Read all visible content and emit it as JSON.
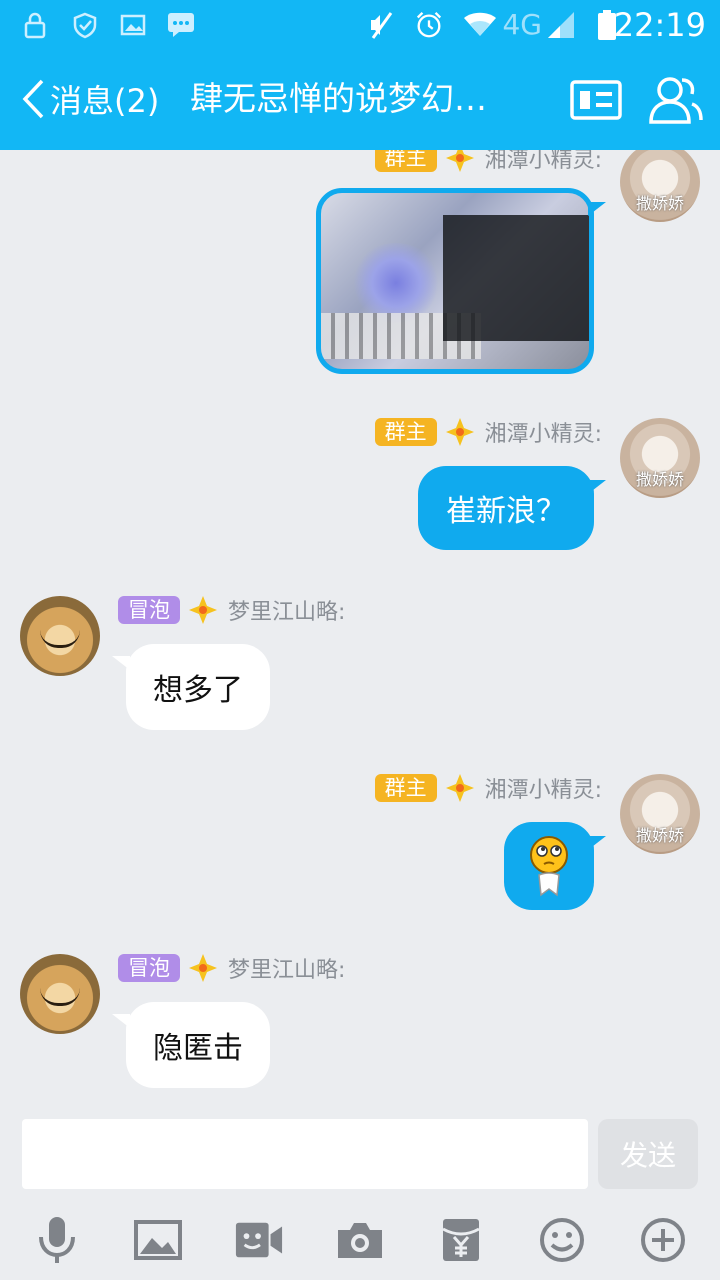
{
  "status_bar": {
    "network": "4G",
    "time": "22:19",
    "icons": [
      "lock-icon",
      "shield-icon",
      "image-icon",
      "message-icon",
      "mute-icon",
      "alarm-icon",
      "wifi-icon",
      "signal-icon",
      "battery-icon"
    ]
  },
  "header": {
    "back_label": "消息(2)",
    "title": "肆无忌惮的说梦幻…",
    "icons": [
      "profile-card-icon",
      "group-members-icon"
    ]
  },
  "messages": [
    {
      "type": "image",
      "side": "out",
      "badge": "群主",
      "sender": "湘潭小精灵:",
      "avatar_caption": "撒娇娇"
    },
    {
      "type": "text",
      "side": "out",
      "badge": "群主",
      "sender": "湘潭小精灵:",
      "text": "崔新浪？",
      "avatar_caption": "撒娇娇"
    },
    {
      "type": "text",
      "side": "in",
      "badge": "冒泡",
      "sender": "梦里江山略:",
      "text": "想多了"
    },
    {
      "type": "emoji",
      "side": "out",
      "badge": "群主",
      "sender": "湘潭小精灵:",
      "emoji": "thinking-face",
      "avatar_caption": "撒娇娇"
    },
    {
      "type": "text",
      "side": "in",
      "badge": "冒泡",
      "sender": "梦里江山略:",
      "text": "隐匿击"
    }
  ],
  "input": {
    "value": "",
    "send_label": "发送"
  },
  "toolbar": [
    "microphone-icon",
    "picture-icon",
    "video-call-icon",
    "camera-icon",
    "red-packet-icon",
    "emoji-icon",
    "plus-icon"
  ],
  "colors": {
    "header_bg": "#12b7f5",
    "bubble_out": "#10aaee",
    "owner_badge": "#f5b422",
    "member_badge": "#b08de8",
    "chat_bg": "#ebedf0"
  }
}
